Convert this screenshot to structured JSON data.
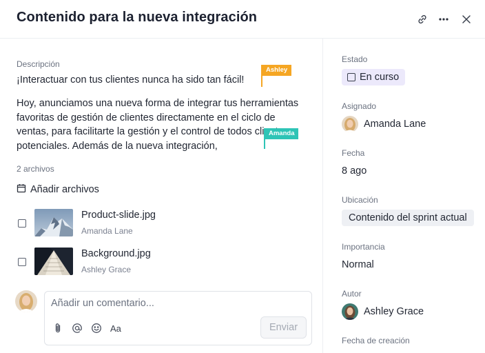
{
  "header": {
    "title": "Contenido para la nueva integración",
    "icons": [
      "link-icon",
      "more-icon",
      "close-icon"
    ]
  },
  "description": {
    "label": "Descripción",
    "paragraph1": "¡Interactuar con tus clientes nunca ha sido tan fácil!",
    "paragraph2": "Hoy, anunciamos una nueva forma de integrar tus herramientas favoritas de gestión de clientes directamente en el ciclo de ventas, para facilitarte la gestión y el control de todos clientes potenciales. Además de la nueva integración,"
  },
  "cursors": [
    {
      "name": "Ashley",
      "color": "#f5a623"
    },
    {
      "name": "Amanda",
      "color": "#2ec4b6"
    }
  ],
  "files": {
    "count_label": "2 archivos",
    "add_label": "Añadir archivos",
    "items": [
      {
        "name": "Product-slide.jpg",
        "owner": "Amanda Lane"
      },
      {
        "name": "Background.jpg",
        "owner": "Ashley Grace"
      }
    ]
  },
  "comment": {
    "placeholder": "Añadir un comentario...",
    "format_label": "Aa",
    "send_label": "Enviar"
  },
  "sidebar": {
    "status": {
      "label": "Estado",
      "value": "En curso",
      "color": "#ece9fb"
    },
    "assignee": {
      "label": "Asignado",
      "value": "Amanda Lane"
    },
    "date": {
      "label": "Fecha",
      "value": "8 ago"
    },
    "location": {
      "label": "Ubicación",
      "value": "Contenido del sprint actual"
    },
    "priority": {
      "label": "Importancia",
      "value": "Normal"
    },
    "author": {
      "label": "Autor",
      "value": "Ashley Grace"
    },
    "created": {
      "label": "Fecha de creación"
    }
  }
}
